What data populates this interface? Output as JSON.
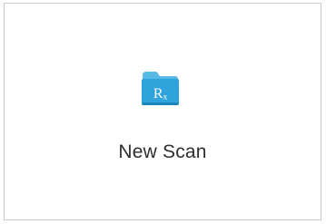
{
  "new_scan_tile": {
    "label": "New Scan",
    "icon": "rx-folder-icon",
    "icon_glyph": "Rₓ"
  },
  "colors": {
    "folder_body": "#2fa3dc",
    "folder_tab": "#58b8e6",
    "folder_shadow": "#1f86bd",
    "tile_border": "#c9c9c9",
    "label": "#2e2e2e"
  }
}
